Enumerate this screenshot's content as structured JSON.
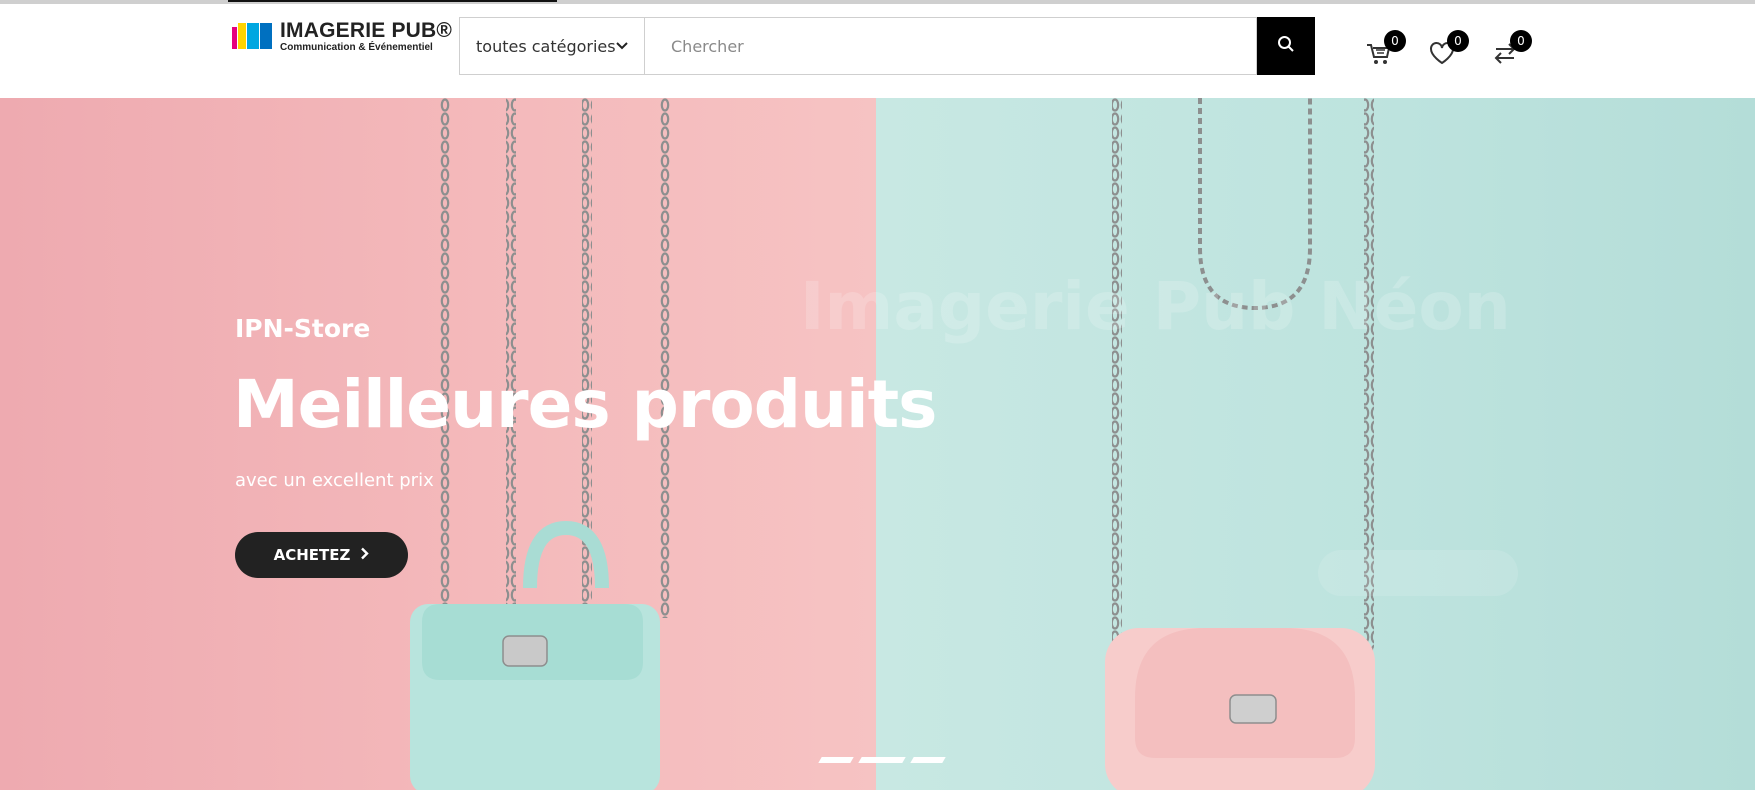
{
  "header": {
    "logo": {
      "title": "IMAGERIE PUB®",
      "subtitle": "Communication & Événementiel"
    },
    "category_select": {
      "selected": "toutes catégories",
      "chevron_icon": "chevron-down-icon"
    },
    "search": {
      "placeholder": "Chercher",
      "value": "",
      "button_icon": "search-icon"
    },
    "cart": {
      "icon": "cart-icon",
      "count": "0"
    },
    "wishlist": {
      "icon": "heart-icon",
      "count": "0"
    },
    "compare": {
      "icon": "compare-arrows-icon",
      "count": "0"
    }
  },
  "hero": {
    "kicker": "IPN-Store",
    "title": "Meilleures produits",
    "subtitle": "avec un excellent prix",
    "cta_label": "ACHETEZ",
    "cta_icon": "chevron-right-icon",
    "ghost_next_title": "Imagerie Pub Néon",
    "slide_indicators": 3,
    "active_slide": 1,
    "colors": {
      "left_bg": "#f4b9bb",
      "right_bg": "#bde3de",
      "cta_bg": "#222222"
    }
  }
}
